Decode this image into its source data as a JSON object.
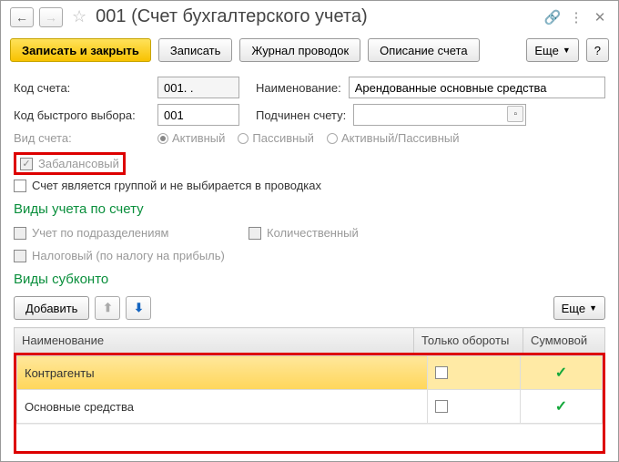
{
  "title": "001 (Счет бухгалтерского учета)",
  "toolbar": {
    "save_close": "Записать и закрыть",
    "save": "Записать",
    "journal": "Журнал проводок",
    "desc": "Описание счета",
    "more": "Еще",
    "help": "?"
  },
  "form": {
    "code_label": "Код счета:",
    "code_value": "001. .",
    "name_label": "Наименование:",
    "name_value": "Арендованные основные средства",
    "quick_label": "Код быстрого выбора:",
    "quick_value": "001",
    "parent_label": "Подчинен счету:",
    "parent_value": "",
    "type_label": "Вид счета:",
    "radio_active": "Активный",
    "radio_passive": "Пассивный",
    "radio_both": "Активный/Пассивный",
    "offbalance": "Забалансовый",
    "isgroup": "Счет является группой и не выбирается в проводках"
  },
  "sections": {
    "accounting_types": "Виды учета по счету",
    "by_dept": "Учет по подразделениям",
    "quantitative": "Количественный",
    "tax": "Налоговый (по налогу на прибыль)",
    "subkonto": "Виды субконто"
  },
  "subtoolbar": {
    "add": "Добавить",
    "more": "Еще"
  },
  "table": {
    "columns": {
      "name": "Наименование",
      "turnover": "Только обороты",
      "sum": "Суммовой"
    },
    "rows": [
      {
        "name": "Контрагенты",
        "turnover": false,
        "sum": true,
        "highlight": true
      },
      {
        "name": "Основные средства",
        "turnover": false,
        "sum": true,
        "highlight": false
      }
    ]
  }
}
